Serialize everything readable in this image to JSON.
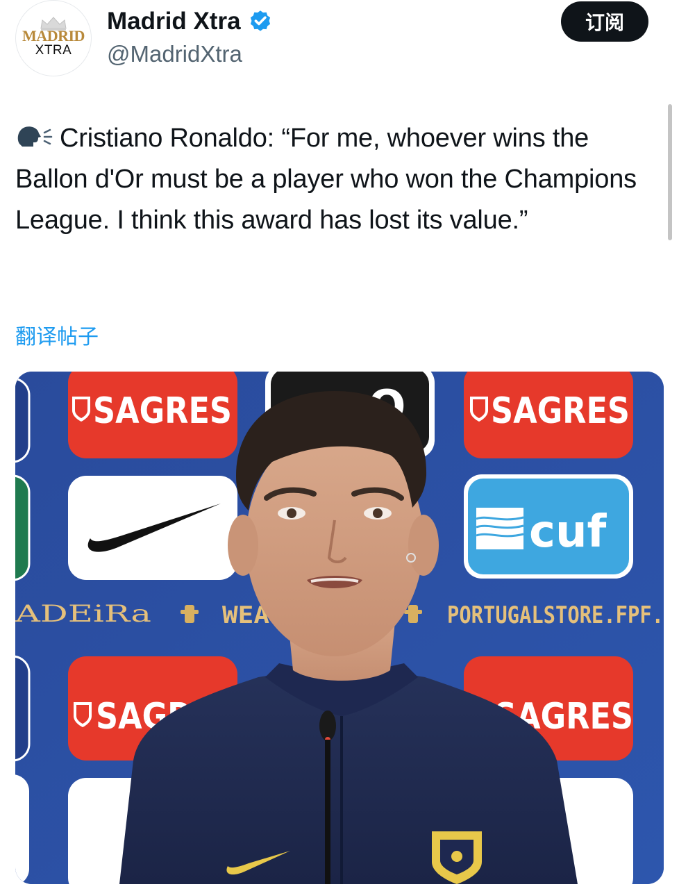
{
  "account": {
    "display_name": "Madrid Xtra",
    "handle": "@MadridXtra",
    "avatar_logo_top": "MADRID",
    "avatar_logo_bottom": "XTRA",
    "verified": true
  },
  "subscribe_label": "订阅",
  "tweet": {
    "emoji_icon": "speaking-head-icon",
    "text": "Cristiano Ronaldo: “For me, whoever wins the Ballon d'Or must be a player who won the Champions League. I think this award has lost its value.”"
  },
  "translate_label": "翻译帖子",
  "media": {
    "backdrop_text": {
      "sagres": "SAGRES",
      "cuf": "cuf",
      "store": "PORTUGALSTORE.FPF.",
      "wear": "WEA",
      "madeira": "ADEiRa",
      "meo": "O"
    }
  },
  "colors": {
    "accent_link": "#1d9bf0",
    "verified_blue": "#1d9bf0",
    "button_bg": "#0f1419",
    "backdrop_blue": "#2b4fa0",
    "sagres_red": "#e6392b",
    "cuf_blue": "#3ea7e0"
  }
}
